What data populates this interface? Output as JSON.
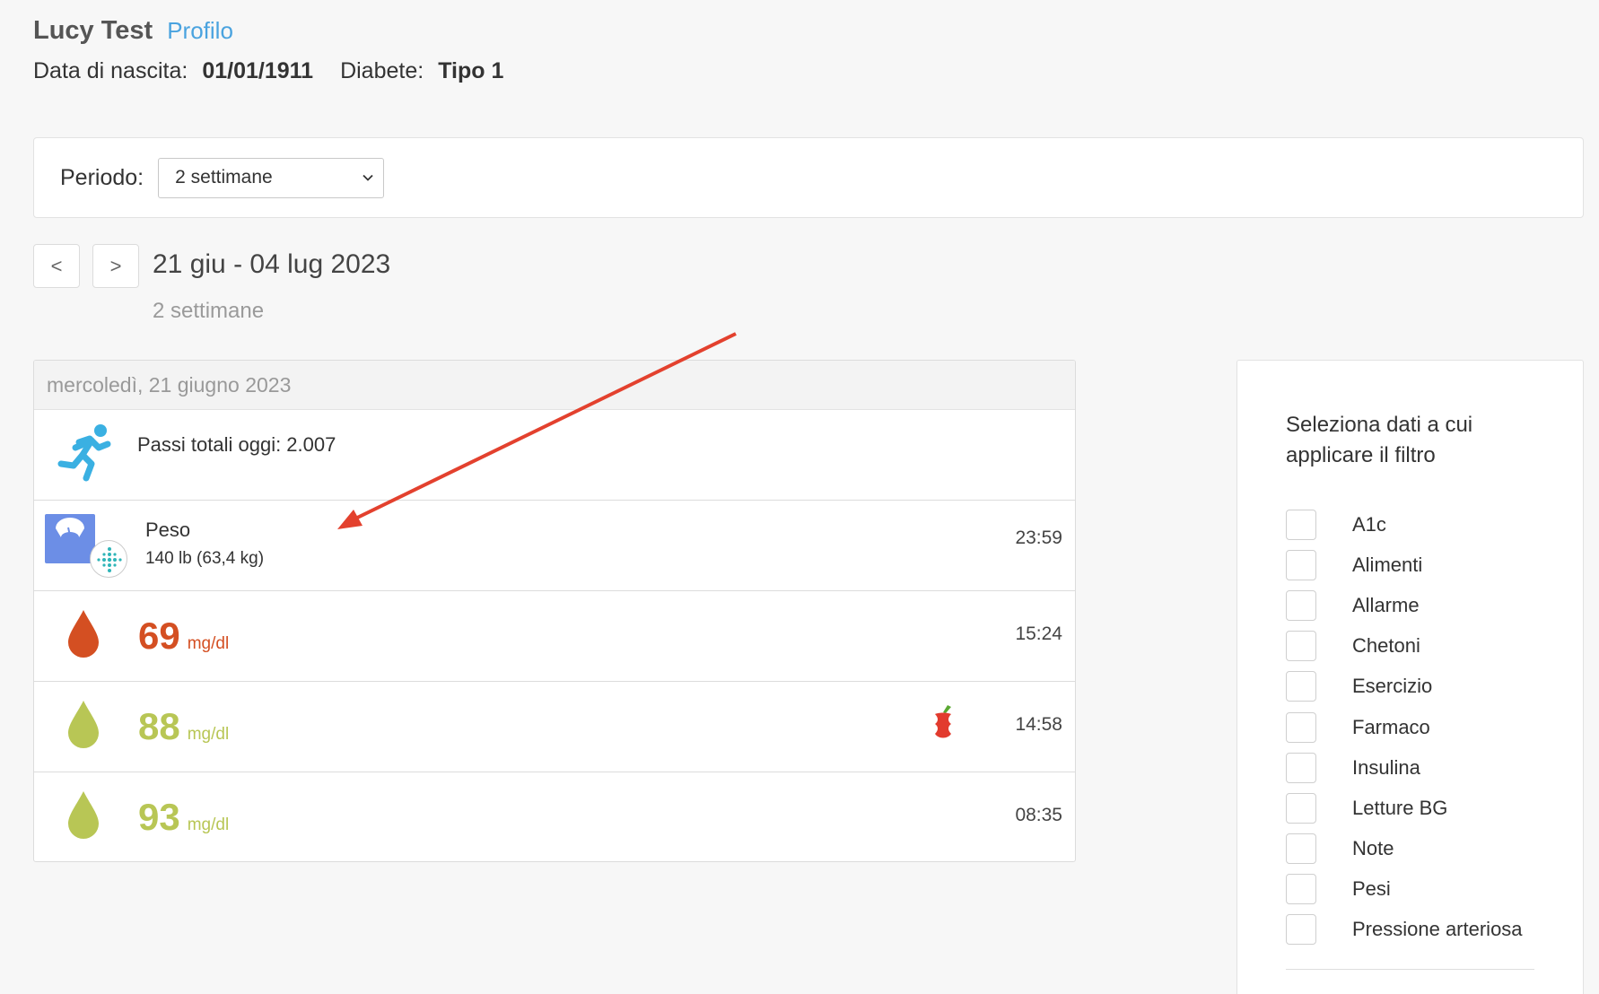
{
  "patient": {
    "name": "Lucy Test",
    "profile_link": "Profilo",
    "birth_label": "Data di nascita:",
    "birth_value": "01/01/1911",
    "diabetes_label": "Diabete:",
    "diabetes_value": "Tipo 1"
  },
  "period": {
    "label": "Periodo:",
    "selected": "2 settimane"
  },
  "navigation": {
    "prev_label": "<",
    "next_label": ">",
    "date_range": "21 giu - 04 lug 2023",
    "range_subtitle": "2 settimane"
  },
  "log": {
    "day_header": "mercoledì, 21 giugno 2023",
    "steps": {
      "text": "Passi totali oggi: 2.007",
      "icon": "running-icon"
    },
    "weight": {
      "title": "Peso",
      "value": "140 lb (63,4 kg)",
      "time": "23:59",
      "icon": "scale-icon",
      "badge_icon": "fitbit-icon"
    },
    "bg_entries": [
      {
        "value": "69",
        "unit": "mg/dl",
        "time": "15:24",
        "color": "#d44f22",
        "meal": false
      },
      {
        "value": "88",
        "unit": "mg/dl",
        "time": "14:58",
        "color": "#b8c655",
        "meal": true
      },
      {
        "value": "93",
        "unit": "mg/dl",
        "time": "08:35",
        "color": "#b8c655",
        "meal": false
      }
    ]
  },
  "filters": {
    "title": "Seleziona dati a cui applicare il filtro",
    "items": [
      "A1c",
      "Alimenti",
      "Allarme",
      "Chetoni",
      "Esercizio",
      "Farmaco",
      "Insulina",
      "Letture BG",
      "Note",
      "Pesi",
      "Pressione arteriosa"
    ]
  },
  "colors": {
    "link": "#4aa3df",
    "low_bg": "#d44f22",
    "normal_bg": "#b8c655",
    "annotation_arrow": "#e3412e",
    "steps_icon": "#3ab0e2",
    "scale_icon": "#6c8ee6"
  }
}
